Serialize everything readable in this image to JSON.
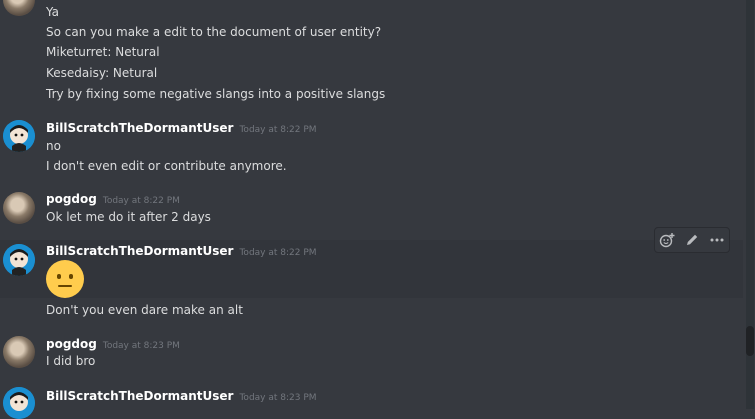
{
  "messages_top": [
    "Ya",
    "So can you make a edit to the document of user entity?",
    "Miketurret: Netural",
    "Kesedaisy: Netural",
    "Try by fixing some negative slangs into a positive slangs"
  ],
  "group1": {
    "username": "BillScratchTheDormantUser",
    "timestamp": "Today at 8:22 PM",
    "lines": [
      "no",
      "I don't even edit or contribute anymore."
    ]
  },
  "group2": {
    "username": "pogdog",
    "timestamp": "Today at 8:22 PM",
    "lines": [
      "Ok let me do it after 2 days"
    ]
  },
  "group3": {
    "username": "BillScratchTheDormantUser",
    "timestamp": "Today at 8:22 PM",
    "emoji": "neutral-face-emoji",
    "lines": [
      "Don't you even dare make an alt"
    ]
  },
  "group4": {
    "username": "pogdog",
    "timestamp": "Today at 8:23 PM",
    "lines": [
      "I did bro"
    ]
  },
  "group5": {
    "username": "BillScratchTheDormantUser",
    "timestamp": "Today at 8:23 PM"
  },
  "toolbar": {
    "icons": [
      "add-reaction-icon",
      "edit-pencil-icon",
      "more-options-icon"
    ]
  },
  "colors": {
    "background": "#36393f",
    "hover": "#32353b",
    "username": "#ffffff",
    "timestamp": "#72767d",
    "text": "#dcddde",
    "bill_avatar": "#1a8fd1",
    "emoji": "#ffcc4d"
  }
}
